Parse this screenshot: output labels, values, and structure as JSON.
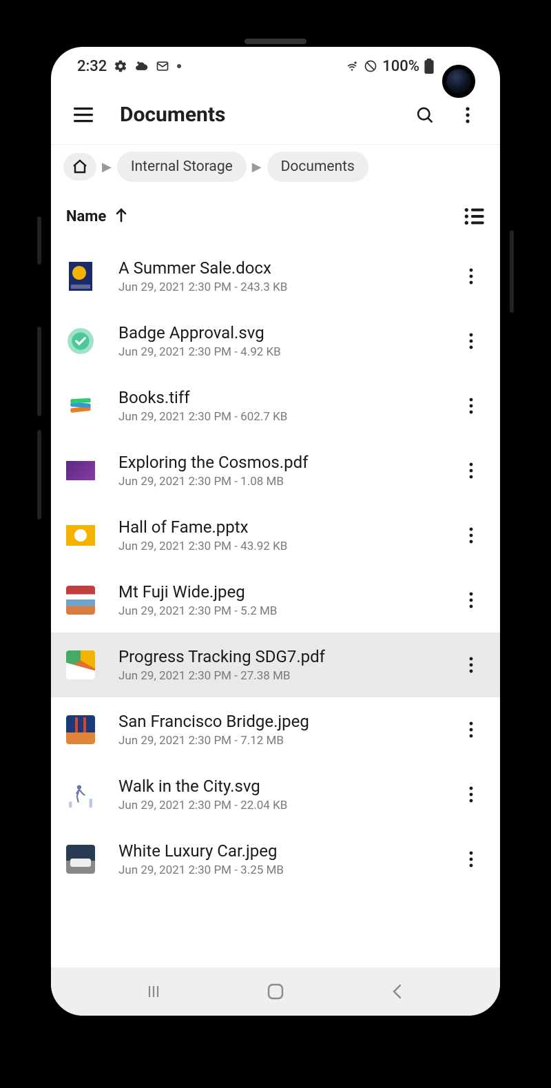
{
  "status": {
    "time": "2:32",
    "battery": "100%"
  },
  "appbar": {
    "title": "Documents"
  },
  "breadcrumb": {
    "items": [
      "Internal Storage",
      "Documents"
    ]
  },
  "sort": {
    "label": "Name"
  },
  "files": [
    {
      "name": "A Summer Sale.docx",
      "meta": "Jun 29, 2021 2:30 PM - 243.3 KB",
      "thumb": "doc-dark",
      "selected": false
    },
    {
      "name": "Badge Approval.svg",
      "meta": "Jun 29, 2021 2:30 PM - 4.92 KB",
      "thumb": "badge",
      "selected": false
    },
    {
      "name": "Books.tiff",
      "meta": "Jun 29, 2021 2:30 PM - 602.7 KB",
      "thumb": "books",
      "selected": false
    },
    {
      "name": "Exploring the Cosmos.pdf",
      "meta": "Jun 29, 2021 2:30 PM - 1.08 MB",
      "thumb": "cosmos",
      "selected": false
    },
    {
      "name": "Hall of Fame.pptx",
      "meta": "Jun 29, 2021 2:30 PM - 43.92 KB",
      "thumb": "fame",
      "selected": false
    },
    {
      "name": "Mt Fuji Wide.jpeg",
      "meta": "Jun 29, 2021 2:30 PM - 5.2 MB",
      "thumb": "fuji",
      "selected": false
    },
    {
      "name": "Progress Tracking SDG7.pdf",
      "meta": "Jun 29, 2021 2:30 PM - 27.38 MB",
      "thumb": "sdg",
      "selected": true
    },
    {
      "name": "San Francisco Bridge.jpeg",
      "meta": "Jun 29, 2021 2:30 PM - 7.12 MB",
      "thumb": "bridge",
      "selected": false
    },
    {
      "name": "Walk in the City.svg",
      "meta": "Jun 29, 2021 2:30 PM - 22.04 KB",
      "thumb": "walk",
      "selected": false
    },
    {
      "name": "White Luxury Car.jpeg",
      "meta": "Jun 29, 2021 2:30 PM - 3.25 MB",
      "thumb": "car",
      "selected": false
    }
  ]
}
